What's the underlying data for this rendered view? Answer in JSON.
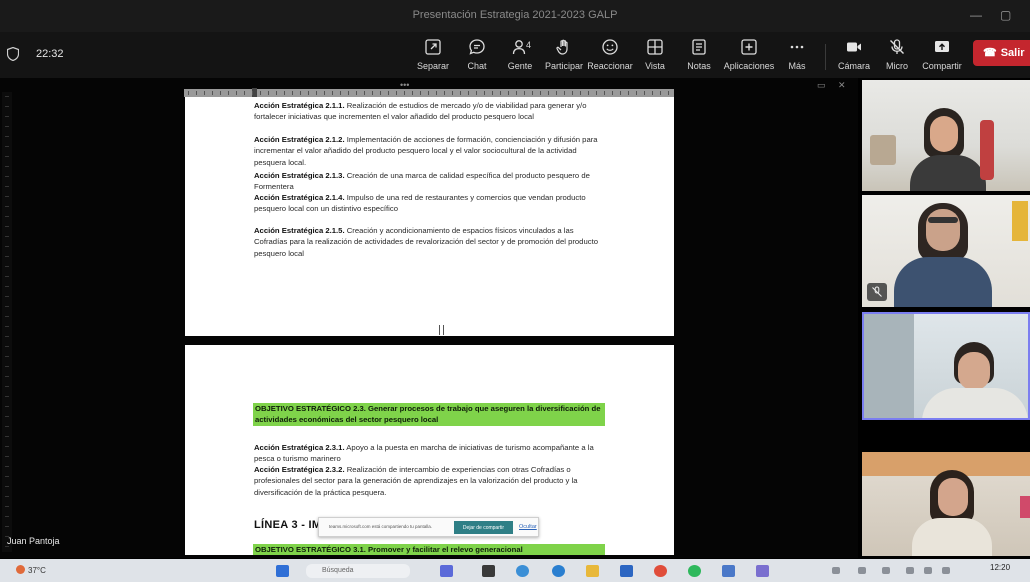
{
  "window": {
    "title": "Presentación Estrategia 2021-2023 GALP"
  },
  "meeting": {
    "timer": "22:32",
    "participants_count": "4",
    "toolbar": [
      {
        "id": "separar",
        "label": "Separar",
        "icon": "pop-out-icon"
      },
      {
        "id": "chat",
        "label": "Chat",
        "icon": "chat-icon"
      },
      {
        "id": "gente",
        "label": "Gente",
        "icon": "people-icon"
      },
      {
        "id": "participar",
        "label": "Participar",
        "icon": "raise-hand-icon"
      },
      {
        "id": "reaccionar",
        "label": "Reaccionar",
        "icon": "smiley-icon"
      },
      {
        "id": "vista",
        "label": "Vista",
        "icon": "grid-view-icon"
      },
      {
        "id": "notas",
        "label": "Notas",
        "icon": "notes-icon"
      },
      {
        "id": "aplicaciones",
        "label": "Aplicaciones",
        "icon": "add-apps-icon"
      },
      {
        "id": "mas",
        "label": "Más",
        "icon": "more-icon"
      },
      {
        "id": "camara",
        "label": "Cámara",
        "icon": "camera-icon"
      },
      {
        "id": "micro",
        "label": "Micro",
        "icon": "mic-off-icon"
      },
      {
        "id": "compartir",
        "label": "Compartir",
        "icon": "share-icon"
      }
    ],
    "leave_label": "Salir",
    "presenter_name": "Juan Pantoja"
  },
  "document": {
    "page1": [
      {
        "bold": "Acción Estratégica 2.1.1.",
        "text": " Realización de estudios de mercado y/o de viabilidad para generar y/o fortalecer iniciativas que incrementen el valor añadido del producto pesquero local"
      },
      {
        "bold": "Acción Estratégica 2.1.2.",
        "text": " Implementación de acciones de formación, concienciación y difusión para incrementar el valor añadido del producto pesquero local y el valor sociocultural de la actividad pesquera local."
      },
      {
        "bold": "Acción Estratégica 2.1.3.",
        "text": " Creación de una marca de calidad específica del producto pesquero de Formentera"
      },
      {
        "bold": "Acción Estratégica 2.1.4.",
        "text": " Impulso de una red de restaurantes y comercios que vendan producto pesquero local con un distintivo específico"
      },
      {
        "bold": "Acción Estratégica 2.1.5.",
        "text": " Creación y acondicionamiento de espacios físicos vinculados a las Cofradías para la realización de actividades de revalorización del sector y de promoción del producto pesquero local"
      }
    ],
    "page2": {
      "objective_23": "OBJETIVO ESTRATÉGICO 2.3. Generar procesos de trabajo que aseguren la diversificación de actividades económicas del sector pesquero local",
      "actions": [
        {
          "bold": "Acción Estratégica 2.3.1.",
          "text": " Apoyo a la puesta en marcha de iniciativas de turismo acompañante a la pesca o turismo marinero"
        },
        {
          "bold": "Acción Estratégica 2.3.2.",
          "text": " Realización de intercambio de experiencias con otras Cofradías o profesionales del sector para la generación de aprendizajes en la valorización del producto y la diversificación de la práctica pesquera."
        }
      ],
      "line_heading": "LÍNEA 3 - IMP",
      "objective_31": "OBJETIVO ESTRATÉGICO 3.1. Promover y facilitar el relevo generacional"
    }
  },
  "share_notice": {
    "message": "teams.microsoft.com está compartiendo tu pantalla.",
    "stop_label": "Dejar de compartir",
    "hide_label": "Ocultar"
  },
  "taskbar": {
    "weather": "37°C",
    "search_placeholder": "Búsqueda",
    "clock": "12:20"
  },
  "colors": {
    "highlight": "#7fd34a",
    "leave": "#c4262e",
    "active_speaker": "#7b7ef0"
  }
}
